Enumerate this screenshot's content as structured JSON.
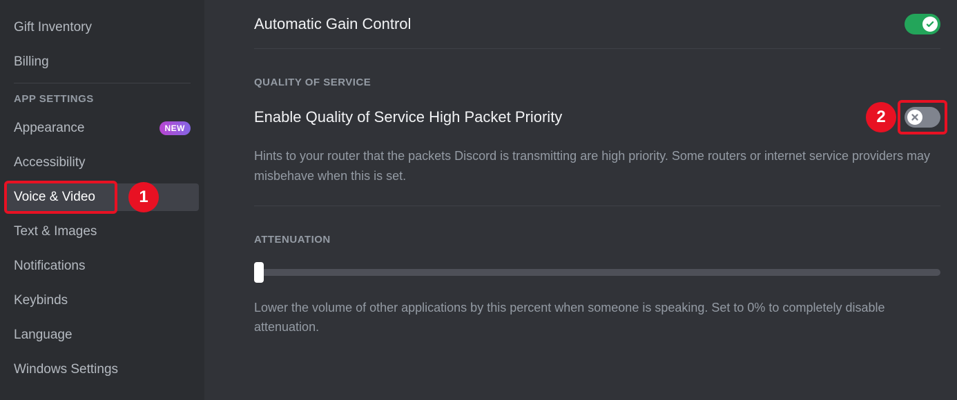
{
  "sidebar": {
    "gift_inventory": "Gift Inventory",
    "billing": "Billing",
    "app_settings_header": "APP SETTINGS",
    "appearance": "Appearance",
    "new_badge": "NEW",
    "accessibility": "Accessibility",
    "voice_video": "Voice & Video",
    "text_images": "Text & Images",
    "notifications": "Notifications",
    "keybinds": "Keybinds",
    "language": "Language",
    "windows_settings": "Windows Settings"
  },
  "main": {
    "auto_gain": {
      "label": "Automatic Gain Control",
      "enabled": true
    },
    "qos": {
      "header": "QUALITY OF SERVICE",
      "label": "Enable Quality of Service High Packet Priority",
      "enabled": false,
      "desc": "Hints to your router that the packets Discord is transmitting are high priority. Some routers or internet service providers may misbehave when this is set."
    },
    "attenuation": {
      "header": "ATTENUATION",
      "value": 0,
      "desc": "Lower the volume of other applications by this percent when someone is speaking. Set to 0% to completely disable attenuation."
    }
  },
  "annotations": {
    "one": "1",
    "two": "2"
  }
}
